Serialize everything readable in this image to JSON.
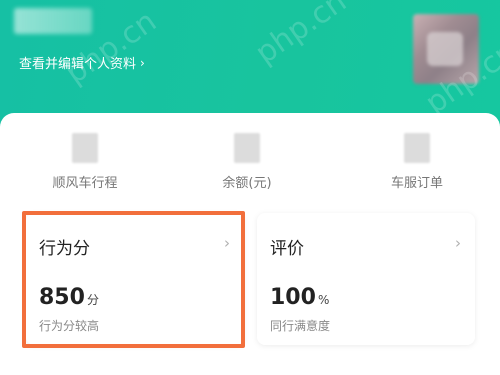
{
  "header": {
    "edit_profile_label": "查看并编辑个人资料",
    "edit_profile_chevron": "›"
  },
  "quick_links": [
    {
      "label": "顺风车行程"
    },
    {
      "label": "余额(元)"
    },
    {
      "label": "车服订单"
    }
  ],
  "tiles": {
    "behavior": {
      "title": "行为分",
      "value": "850",
      "unit": "分",
      "subtitle": "行为分较高",
      "arrow": "›"
    },
    "rating": {
      "title": "评价",
      "value": "100",
      "unit": "%",
      "subtitle": "同行满意度",
      "arrow": "›"
    }
  },
  "watermark": "php.cn",
  "colors": {
    "header_gradient_start": "#16c0a4",
    "header_gradient_end": "#16c7a0",
    "highlight_border": "#f26f3c"
  }
}
